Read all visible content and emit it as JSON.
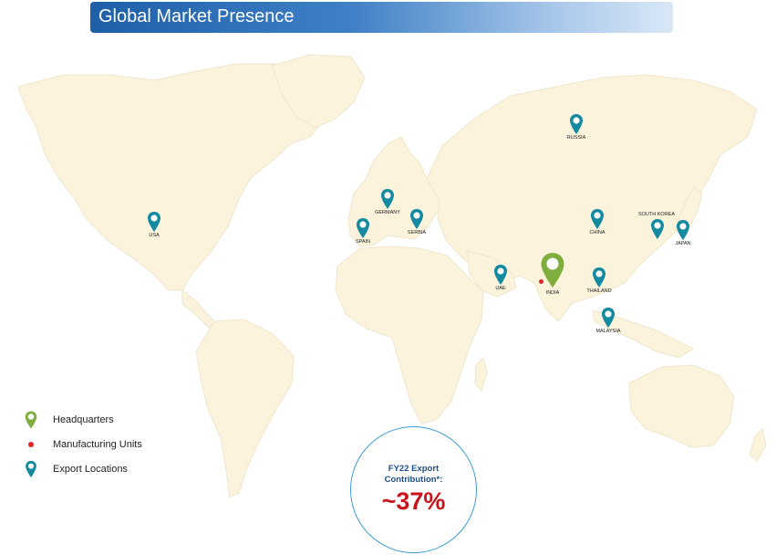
{
  "title": "Global Market Presence",
  "colors": {
    "title_bar": "#1e5fa8",
    "land": "#fbf3dc",
    "export_pin": "#138aa0",
    "hq_pin": "#7fae3f",
    "manufacturing_dot": "#e0242a",
    "kpi_value": "#c8141b",
    "kpi_label": "#1e4f8c"
  },
  "map": {
    "export_locations": [
      {
        "id": "usa",
        "label": "USA"
      },
      {
        "id": "germany",
        "label": "GERMANY"
      },
      {
        "id": "spain",
        "label": "SPAIN"
      },
      {
        "id": "serbia",
        "label": "SERBIA"
      },
      {
        "id": "uae",
        "label": "UAE"
      },
      {
        "id": "russia",
        "label": "RUSSIA"
      },
      {
        "id": "china",
        "label": "CHINA"
      },
      {
        "id": "south-korea",
        "label": "SOUTH KOREA"
      },
      {
        "id": "japan",
        "label": "JAPAN"
      },
      {
        "id": "thailand",
        "label": "THAILAND"
      },
      {
        "id": "malaysia",
        "label": "MALAYSIA"
      }
    ],
    "headquarters": {
      "label": "INDIA"
    }
  },
  "legend": [
    {
      "icon": "hq-pin-icon",
      "label": "Headquarters"
    },
    {
      "icon": "manufacturing-dot-icon",
      "label": "Manufacturing Units"
    },
    {
      "icon": "export-pin-icon",
      "label": "Export Locations"
    }
  ],
  "kpi": {
    "label_line1": "FY22 Export",
    "label_line2": "Contribution*:",
    "value": "~37%"
  }
}
